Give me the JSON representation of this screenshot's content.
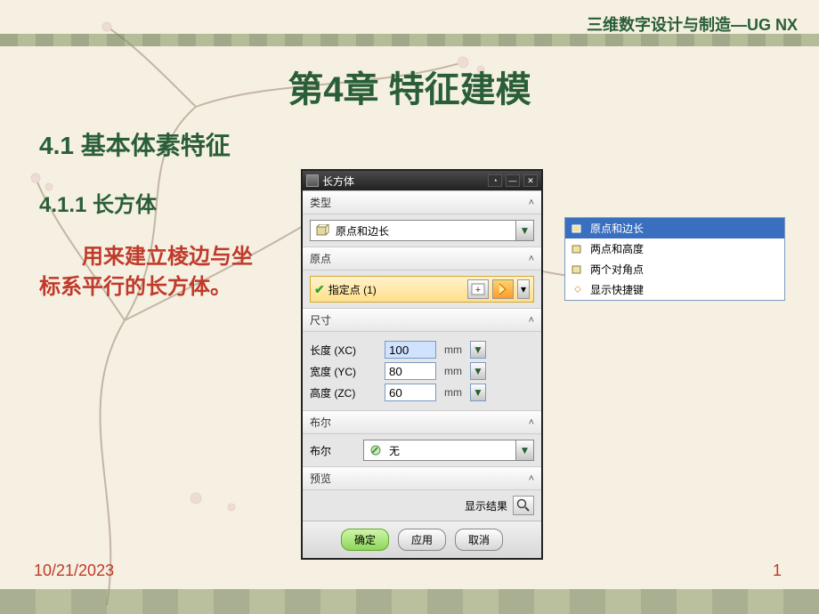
{
  "doc_title": "三维数字设计与制造—UG NX",
  "chapter_title": "第4章 特征建模",
  "section_title": "4.1 基本体素特征",
  "subsection_title": "4.1.1 长方体",
  "body_text": "用来建立棱边与坐标系平行的长方体。",
  "footer_date": "10/21/2023",
  "page_num": "1",
  "dialog": {
    "title": "长方体",
    "sections": {
      "type": "类型",
      "origin": "原点",
      "size": "尺寸",
      "bool": "布尔",
      "preview": "预览"
    },
    "type_selected": "原点和边长",
    "origin_label": "指定点 (1)",
    "dims": [
      {
        "label": "长度 (XC)",
        "value": "100",
        "unit": "mm"
      },
      {
        "label": "宽度 (YC)",
        "value": "80",
        "unit": "mm"
      },
      {
        "label": "高度 (ZC)",
        "value": "60",
        "unit": "mm"
      }
    ],
    "bool_label": "布尔",
    "bool_value": "无",
    "preview_btn": "显示结果",
    "buttons": {
      "ok": "确定",
      "apply": "应用",
      "cancel": "取消"
    }
  },
  "flyout": [
    {
      "label": "原点和边长",
      "selected": true,
      "icon": "cube"
    },
    {
      "label": "两点和高度",
      "selected": false,
      "icon": "cube"
    },
    {
      "label": "两个对角点",
      "selected": false,
      "icon": "cube"
    },
    {
      "label": "显示快捷键",
      "selected": false,
      "icon": "key"
    }
  ]
}
